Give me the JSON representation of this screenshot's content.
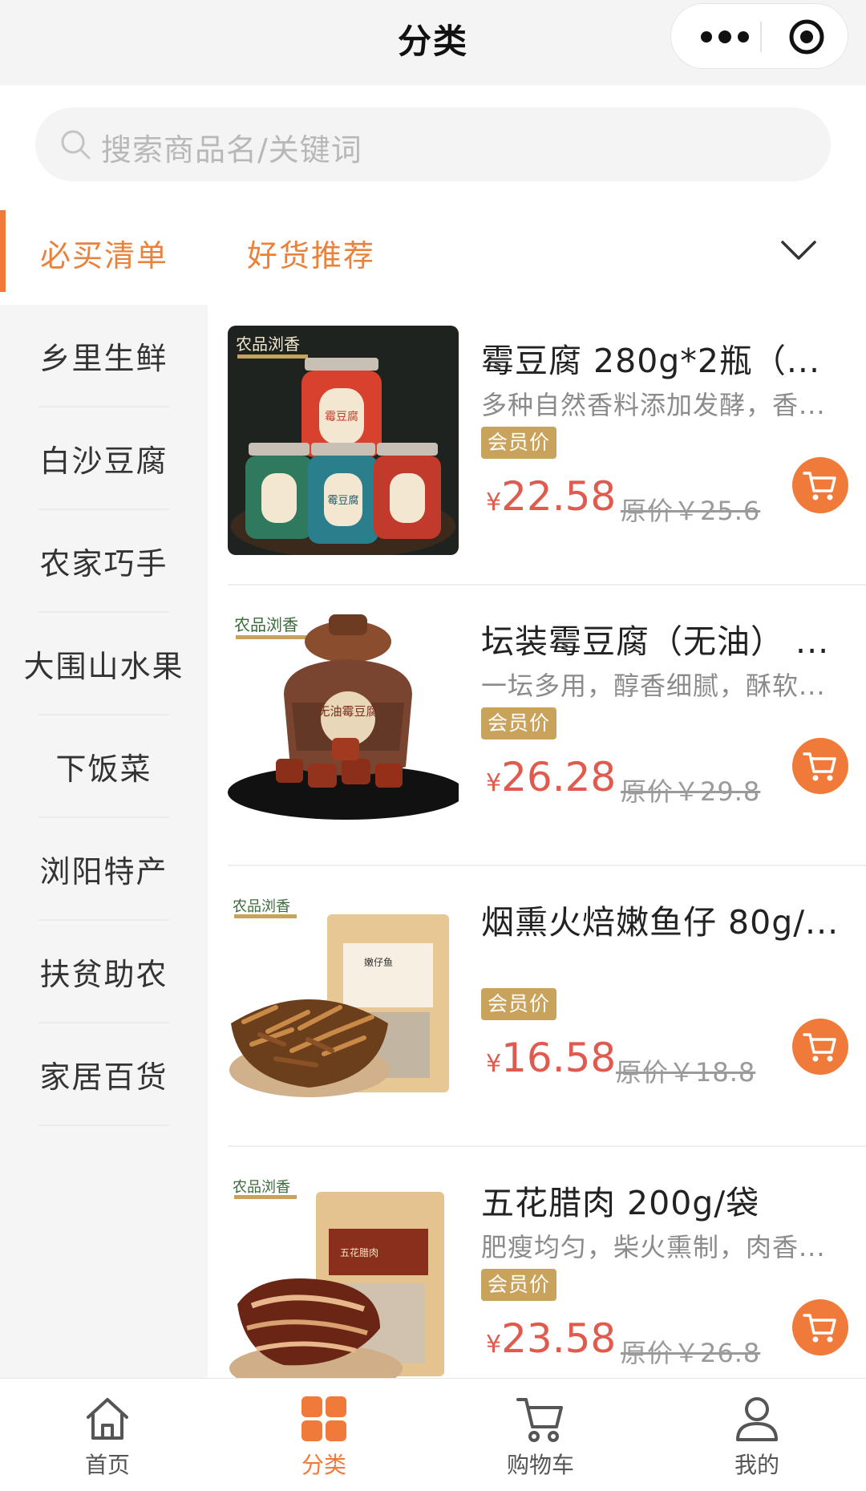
{
  "header": {
    "title": "分类"
  },
  "search": {
    "placeholder": "搜索商品名/关键词"
  },
  "tabs": [
    {
      "label": "必买清单",
      "active": true
    },
    {
      "label": "好货推荐",
      "active": false
    }
  ],
  "sidebar": {
    "items": [
      {
        "label": "乡里生鲜"
      },
      {
        "label": "白沙豆腐"
      },
      {
        "label": "农家巧手"
      },
      {
        "label": "大围山水果"
      },
      {
        "label": "下饭菜"
      },
      {
        "label": "浏阳特产"
      },
      {
        "label": "扶贫助农"
      },
      {
        "label": "家居百货"
      }
    ]
  },
  "products": [
    {
      "name": "霉豆腐 280g*2瓶（...",
      "desc": "多种自然香料添加发酵，香...",
      "badge": "会员价",
      "yen": "¥",
      "price": "22.58",
      "original": "原价￥25.6",
      "brand": "农品浏香",
      "jar_label": "霉豆腐"
    },
    {
      "name": "坛装霉豆腐（无油） ...",
      "desc": "一坛多用，醇香细腻，酥软...",
      "badge": "会员价",
      "yen": "¥",
      "price": "26.28",
      "original": "原价￥29.8",
      "brand": "农品浏香",
      "jar_label": "无油霉豆腐"
    },
    {
      "name": "烟熏火焙嫩鱼仔 80g/...",
      "desc": "",
      "badge": "会员价",
      "yen": "¥",
      "price": "16.58",
      "original": "原价￥18.8",
      "brand": "农品浏香",
      "bag_label": "嫩仔鱼"
    },
    {
      "name": "五花腊肉 200g/袋",
      "desc": "肥瘦均匀，柴火熏制，肉香...",
      "badge": "会员价",
      "yen": "¥",
      "price": "23.58",
      "original": "原价￥26.8",
      "brand": "农品浏香",
      "bag_label": "五花腊肉"
    }
  ],
  "bottom_nav": [
    {
      "label": "首页",
      "icon": "home-icon",
      "active": false
    },
    {
      "label": "分类",
      "icon": "category-icon",
      "active": true
    },
    {
      "label": "购物车",
      "icon": "cart-icon",
      "active": false
    },
    {
      "label": "我的",
      "icon": "user-icon",
      "active": false
    }
  ],
  "colors": {
    "accent": "#f07a3a",
    "price": "#e05a4d",
    "badge": "#c9a35b"
  }
}
